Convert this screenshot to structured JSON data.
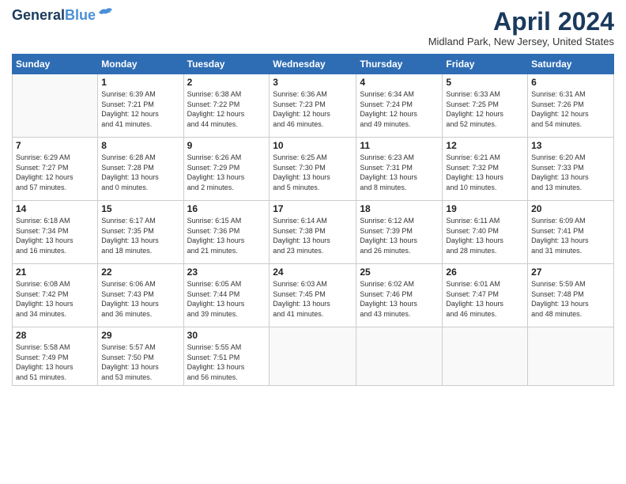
{
  "header": {
    "logo_line1": "General",
    "logo_line2": "Blue",
    "title": "April 2024",
    "location": "Midland Park, New Jersey, United States"
  },
  "days_of_week": [
    "Sunday",
    "Monday",
    "Tuesday",
    "Wednesday",
    "Thursday",
    "Friday",
    "Saturday"
  ],
  "weeks": [
    [
      {
        "day": "",
        "info": ""
      },
      {
        "day": "1",
        "info": "Sunrise: 6:39 AM\nSunset: 7:21 PM\nDaylight: 12 hours\nand 41 minutes."
      },
      {
        "day": "2",
        "info": "Sunrise: 6:38 AM\nSunset: 7:22 PM\nDaylight: 12 hours\nand 44 minutes."
      },
      {
        "day": "3",
        "info": "Sunrise: 6:36 AM\nSunset: 7:23 PM\nDaylight: 12 hours\nand 46 minutes."
      },
      {
        "day": "4",
        "info": "Sunrise: 6:34 AM\nSunset: 7:24 PM\nDaylight: 12 hours\nand 49 minutes."
      },
      {
        "day": "5",
        "info": "Sunrise: 6:33 AM\nSunset: 7:25 PM\nDaylight: 12 hours\nand 52 minutes."
      },
      {
        "day": "6",
        "info": "Sunrise: 6:31 AM\nSunset: 7:26 PM\nDaylight: 12 hours\nand 54 minutes."
      }
    ],
    [
      {
        "day": "7",
        "info": "Sunrise: 6:29 AM\nSunset: 7:27 PM\nDaylight: 12 hours\nand 57 minutes."
      },
      {
        "day": "8",
        "info": "Sunrise: 6:28 AM\nSunset: 7:28 PM\nDaylight: 13 hours\nand 0 minutes."
      },
      {
        "day": "9",
        "info": "Sunrise: 6:26 AM\nSunset: 7:29 PM\nDaylight: 13 hours\nand 2 minutes."
      },
      {
        "day": "10",
        "info": "Sunrise: 6:25 AM\nSunset: 7:30 PM\nDaylight: 13 hours\nand 5 minutes."
      },
      {
        "day": "11",
        "info": "Sunrise: 6:23 AM\nSunset: 7:31 PM\nDaylight: 13 hours\nand 8 minutes."
      },
      {
        "day": "12",
        "info": "Sunrise: 6:21 AM\nSunset: 7:32 PM\nDaylight: 13 hours\nand 10 minutes."
      },
      {
        "day": "13",
        "info": "Sunrise: 6:20 AM\nSunset: 7:33 PM\nDaylight: 13 hours\nand 13 minutes."
      }
    ],
    [
      {
        "day": "14",
        "info": "Sunrise: 6:18 AM\nSunset: 7:34 PM\nDaylight: 13 hours\nand 16 minutes."
      },
      {
        "day": "15",
        "info": "Sunrise: 6:17 AM\nSunset: 7:35 PM\nDaylight: 13 hours\nand 18 minutes."
      },
      {
        "day": "16",
        "info": "Sunrise: 6:15 AM\nSunset: 7:36 PM\nDaylight: 13 hours\nand 21 minutes."
      },
      {
        "day": "17",
        "info": "Sunrise: 6:14 AM\nSunset: 7:38 PM\nDaylight: 13 hours\nand 23 minutes."
      },
      {
        "day": "18",
        "info": "Sunrise: 6:12 AM\nSunset: 7:39 PM\nDaylight: 13 hours\nand 26 minutes."
      },
      {
        "day": "19",
        "info": "Sunrise: 6:11 AM\nSunset: 7:40 PM\nDaylight: 13 hours\nand 28 minutes."
      },
      {
        "day": "20",
        "info": "Sunrise: 6:09 AM\nSunset: 7:41 PM\nDaylight: 13 hours\nand 31 minutes."
      }
    ],
    [
      {
        "day": "21",
        "info": "Sunrise: 6:08 AM\nSunset: 7:42 PM\nDaylight: 13 hours\nand 34 minutes."
      },
      {
        "day": "22",
        "info": "Sunrise: 6:06 AM\nSunset: 7:43 PM\nDaylight: 13 hours\nand 36 minutes."
      },
      {
        "day": "23",
        "info": "Sunrise: 6:05 AM\nSunset: 7:44 PM\nDaylight: 13 hours\nand 39 minutes."
      },
      {
        "day": "24",
        "info": "Sunrise: 6:03 AM\nSunset: 7:45 PM\nDaylight: 13 hours\nand 41 minutes."
      },
      {
        "day": "25",
        "info": "Sunrise: 6:02 AM\nSunset: 7:46 PM\nDaylight: 13 hours\nand 43 minutes."
      },
      {
        "day": "26",
        "info": "Sunrise: 6:01 AM\nSunset: 7:47 PM\nDaylight: 13 hours\nand 46 minutes."
      },
      {
        "day": "27",
        "info": "Sunrise: 5:59 AM\nSunset: 7:48 PM\nDaylight: 13 hours\nand 48 minutes."
      }
    ],
    [
      {
        "day": "28",
        "info": "Sunrise: 5:58 AM\nSunset: 7:49 PM\nDaylight: 13 hours\nand 51 minutes."
      },
      {
        "day": "29",
        "info": "Sunrise: 5:57 AM\nSunset: 7:50 PM\nDaylight: 13 hours\nand 53 minutes."
      },
      {
        "day": "30",
        "info": "Sunrise: 5:55 AM\nSunset: 7:51 PM\nDaylight: 13 hours\nand 56 minutes."
      },
      {
        "day": "",
        "info": ""
      },
      {
        "day": "",
        "info": ""
      },
      {
        "day": "",
        "info": ""
      },
      {
        "day": "",
        "info": ""
      }
    ]
  ]
}
